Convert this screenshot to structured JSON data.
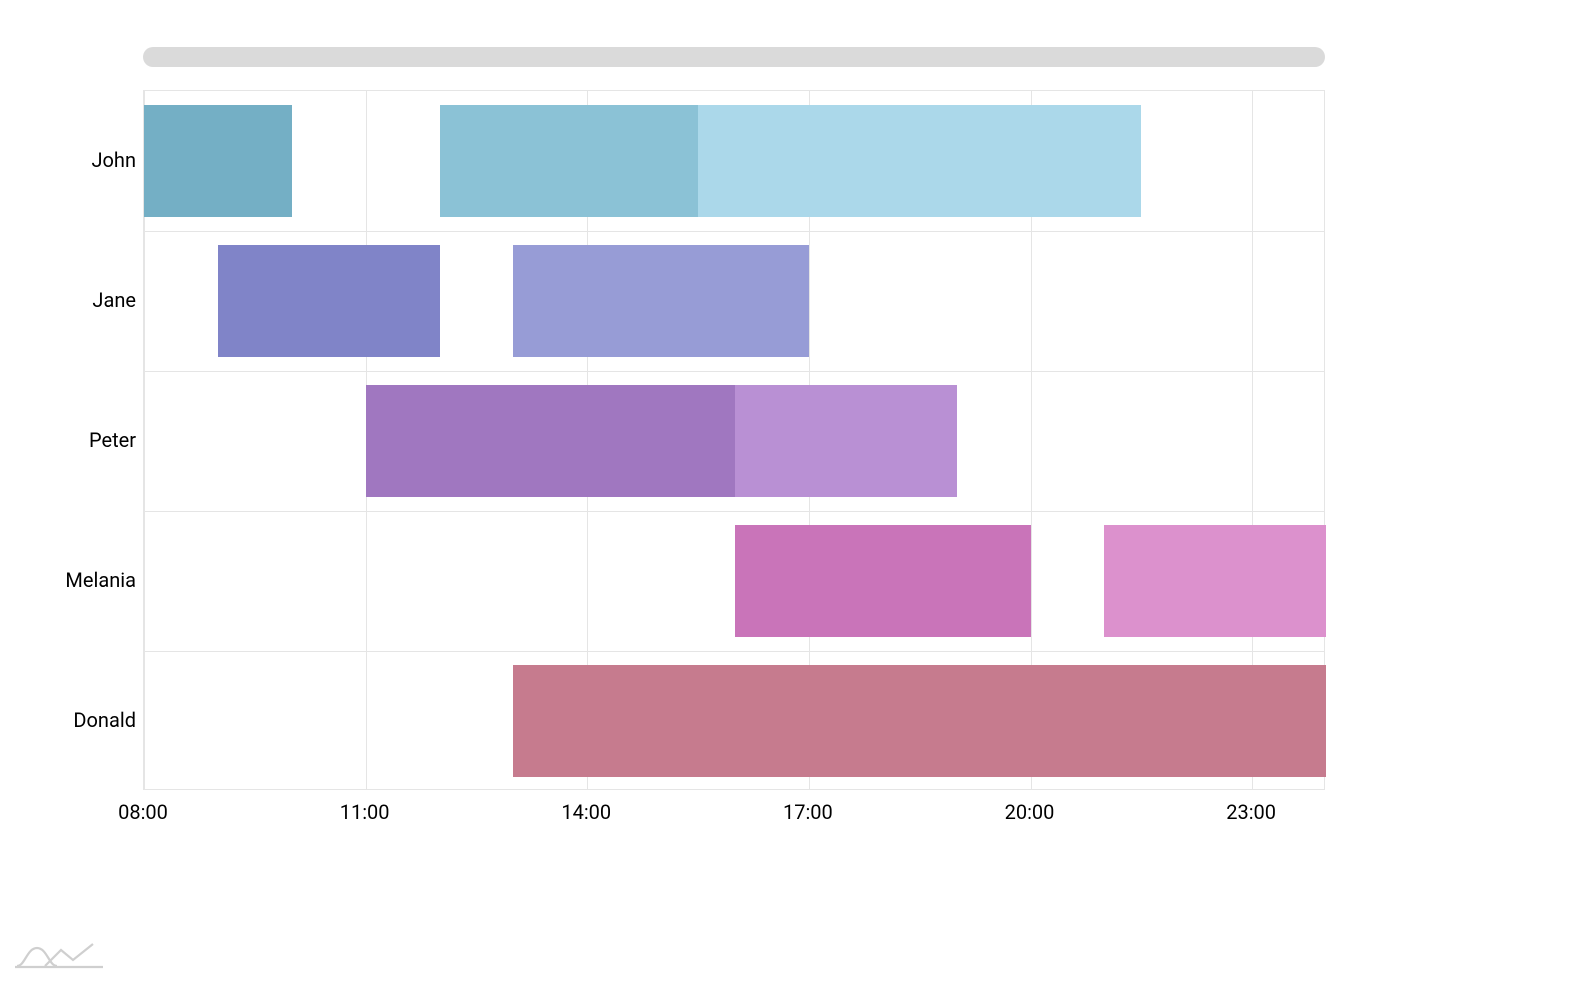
{
  "chart_data": {
    "type": "gantt",
    "x_axis": {
      "type": "time",
      "min": "08:00",
      "max": "24:00",
      "ticks": [
        "08:00",
        "11:00",
        "14:00",
        "17:00",
        "20:00",
        "23:00"
      ]
    },
    "categories": [
      "John",
      "Jane",
      "Peter",
      "Melania",
      "Donald"
    ],
    "bars": [
      {
        "category": "John",
        "start": "08:00",
        "end": "10:00",
        "color": "#74afc5"
      },
      {
        "category": "John",
        "start": "12:00",
        "end": "15:30",
        "color": "#8bc2d6"
      },
      {
        "category": "John",
        "start": "15:30",
        "end": "21:30",
        "color": "#abd8ea"
      },
      {
        "category": "Jane",
        "start": "09:00",
        "end": "12:00",
        "color": "#8084c8"
      },
      {
        "category": "Jane",
        "start": "13:00",
        "end": "17:00",
        "color": "#979cd6"
      },
      {
        "category": "Peter",
        "start": "11:00",
        "end": "16:00",
        "color": "#a077c0"
      },
      {
        "category": "Peter",
        "start": "16:00",
        "end": "19:00",
        "color": "#b990d4"
      },
      {
        "category": "Melania",
        "start": "16:00",
        "end": "20:00",
        "color": "#c974b9"
      },
      {
        "category": "Melania",
        "start": "21:00",
        "end": "24:00",
        "color": "#dc91cd"
      },
      {
        "category": "Donald",
        "start": "13:00",
        "end": "24:00",
        "color": "#c67b8e"
      }
    ],
    "grid": true,
    "legend": false,
    "scrollbar": true
  }
}
